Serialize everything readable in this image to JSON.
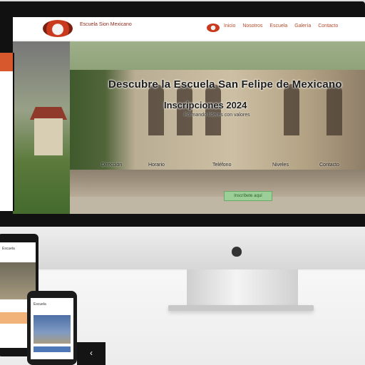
{
  "site": {
    "logo_text": "Escuela Sion Mexicano",
    "nav": [
      "Inicio",
      "Nosotros",
      "Escuela",
      "Galería",
      "Contacto"
    ],
    "hero_title": "Descubre la Escuela San Felipe de Mexicano",
    "hero_subtitle": "Inscripciones 2024",
    "hero_line": "Formando líderes con valores",
    "info": [
      "Dirección",
      "Horario",
      "Teléfono",
      "Niveles",
      "Contacto"
    ],
    "cta_label": "Inscríbete aquí"
  },
  "tablet": {
    "text": "Escuela"
  },
  "phone": {
    "text": "Escuela"
  },
  "back_label": "‹",
  "colors": {
    "accent": "#c9391d",
    "cta": "#9ccf98",
    "tablet_band": "#f1b37a"
  }
}
